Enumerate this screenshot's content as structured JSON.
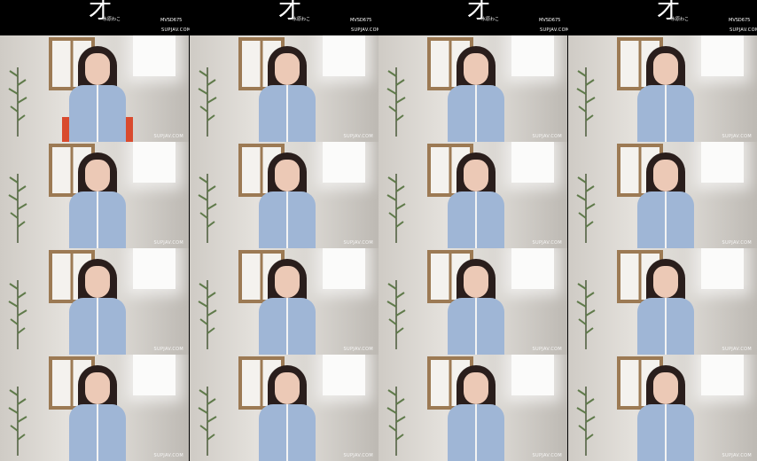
{
  "header": {
    "logo_text": "才",
    "name_text": "水原わこ",
    "code": "MVSD675",
    "watermark": "SUPJAV.COM"
  },
  "tiles": {
    "watermark": "SUPJAV.COM"
  },
  "colors": {
    "background": "#000000",
    "cardigan": "#9fb6d6",
    "window_frame": "#9c7a54",
    "chair": "#d94a2e"
  }
}
